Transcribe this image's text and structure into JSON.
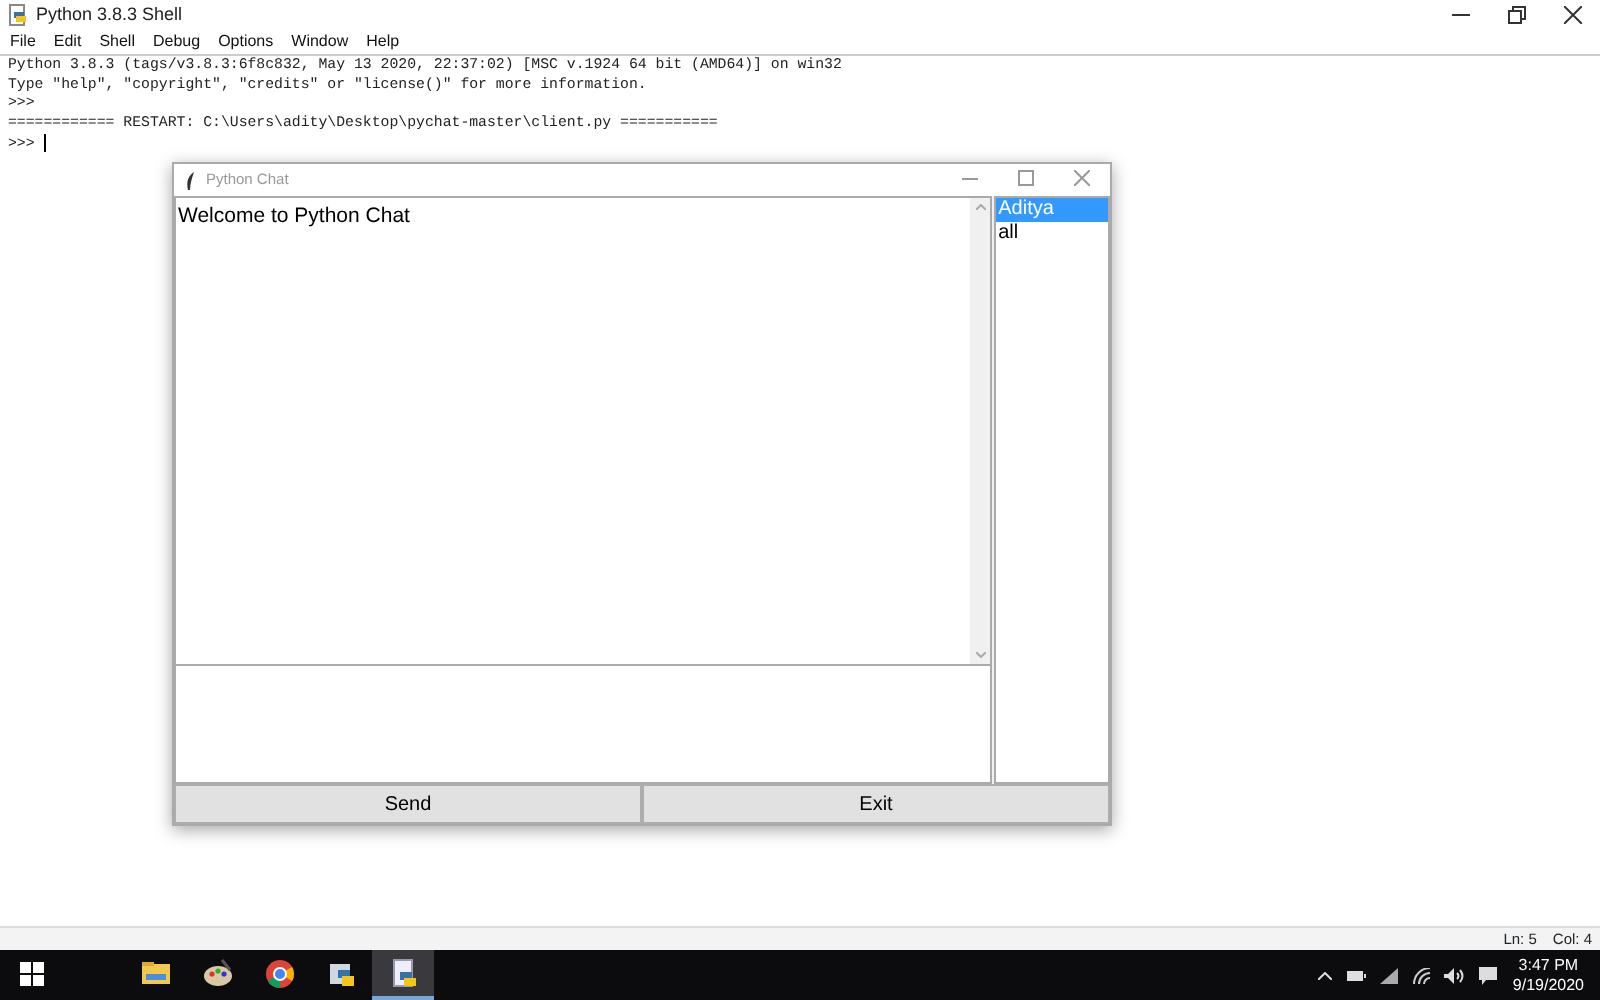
{
  "shell": {
    "title": "Python 3.8.3 Shell",
    "menu": [
      "File",
      "Edit",
      "Shell",
      "Debug",
      "Options",
      "Window",
      "Help"
    ],
    "lines": [
      "Python 3.8.3 (tags/v3.8.3:6f8c832, May 13 2020, 22:37:02) [MSC v.1924 64 bit (AMD64)] on win32",
      "Type \"help\", \"copyright\", \"credits\" or \"license()\" for more information.",
      ">>>",
      "============ RESTART: C:\\Users\\adity\\Desktop\\pychat-master\\client.py ===========",
      ">>>"
    ],
    "status": [
      "Ln: 5",
      "Col: 4"
    ]
  },
  "chat": {
    "title": "Python Chat",
    "messages": [
      "Welcome to Python Chat"
    ],
    "users": [
      {
        "label": "Aditya",
        "selected": true
      },
      {
        "label": "all",
        "selected": false
      }
    ],
    "buttons": [
      "Send",
      "Exit"
    ]
  },
  "taskbar": {
    "apps": [
      {
        "kind": "folder",
        "selected": false
      },
      {
        "kind": "palette",
        "selected": false
      },
      {
        "kind": "browser",
        "selected": false
      },
      {
        "kind": "python",
        "selected": false
      },
      {
        "kind": "python-doc",
        "selected": true
      }
    ],
    "time": "3:47 PM",
    "date": "9/19/2020"
  }
}
